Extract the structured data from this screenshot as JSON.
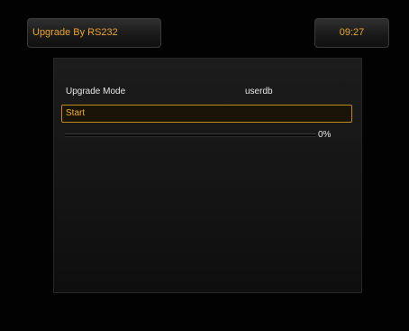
{
  "header": {
    "title": "Upgrade By RS232",
    "clock": "09:27"
  },
  "upgrade": {
    "mode_label": "Upgrade Mode",
    "mode_value": "userdb",
    "start_label": "Start",
    "progress_percent": 0,
    "progress_text": "0%"
  },
  "colors": {
    "accent": "#e8a530",
    "text": "#e6e6e6",
    "highlight_border": "#c08a1e",
    "background": "#000000"
  }
}
